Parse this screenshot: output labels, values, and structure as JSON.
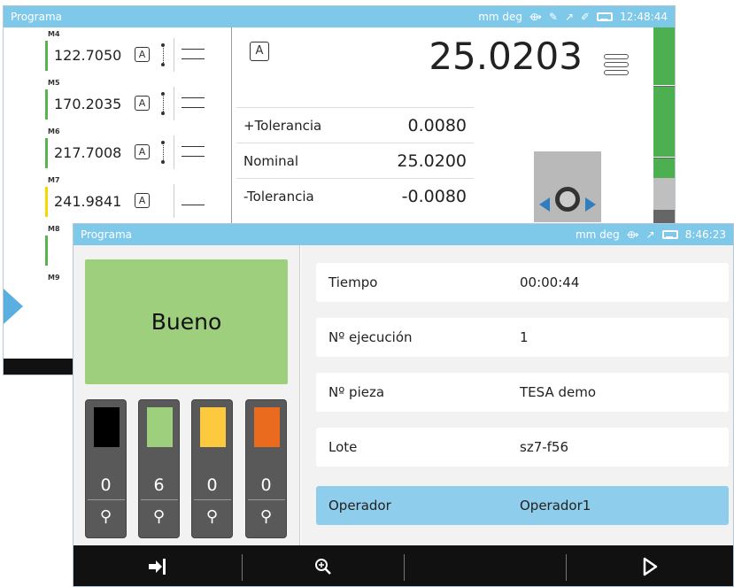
{
  "back_window": {
    "title": "Programa",
    "status": {
      "units": "mm deg",
      "time": "12:48:44"
    },
    "measurements": [
      {
        "label": "M4",
        "value": "122.7050",
        "tag": "A",
        "bar_color": "#57b44e"
      },
      {
        "label": "M5",
        "value": "170.2035",
        "tag": "A",
        "bar_color": "#57b44e"
      },
      {
        "label": "M6",
        "value": "217.7008",
        "tag": "A",
        "bar_color": "#57b44e"
      },
      {
        "label": "M7",
        "value": "241.9841",
        "tag": "A",
        "bar_color": "#f5d800"
      },
      {
        "label": "M8",
        "value": "",
        "tag": "",
        "bar_color": "#57b44e"
      },
      {
        "label": "M9",
        "value": "",
        "tag": "",
        "bar_color": ""
      }
    ],
    "main_tag": "A",
    "main_value": "25.0203",
    "tolerance_rows": [
      {
        "label": "+Tolerancia",
        "value": "0.0080"
      },
      {
        "label": "Nominal",
        "value": "25.0200"
      },
      {
        "label": "-Tolerancia",
        "value": "-0.0080"
      }
    ]
  },
  "front_window": {
    "title": "Programa",
    "status": {
      "units": "mm deg",
      "time": "8:46:23"
    },
    "result": "Bueno",
    "counters": [
      {
        "color": "#000000",
        "value": "0"
      },
      {
        "color": "#9ecf7d",
        "value": "6"
      },
      {
        "color": "#fdc93e",
        "value": "0"
      },
      {
        "color": "#ea6a1e",
        "value": "0"
      }
    ],
    "info": [
      {
        "label": "Tiempo",
        "value": "00:00:44"
      },
      {
        "label": "Nº ejecución",
        "value": "1"
      },
      {
        "label": "Nº pieza",
        "value": "TESA demo"
      },
      {
        "label": "Lote",
        "value": "sz7-f56"
      },
      {
        "label": "Operador",
        "value": "Operador1"
      }
    ]
  },
  "icons": {
    "status_bar": [
      "arrow-circle-icon",
      "probe-icon",
      "signal-icon",
      "pen-icon",
      "battery-icon"
    ],
    "bottom_bar": [
      "exit-icon",
      "zoom-icon",
      "play-icon"
    ]
  }
}
